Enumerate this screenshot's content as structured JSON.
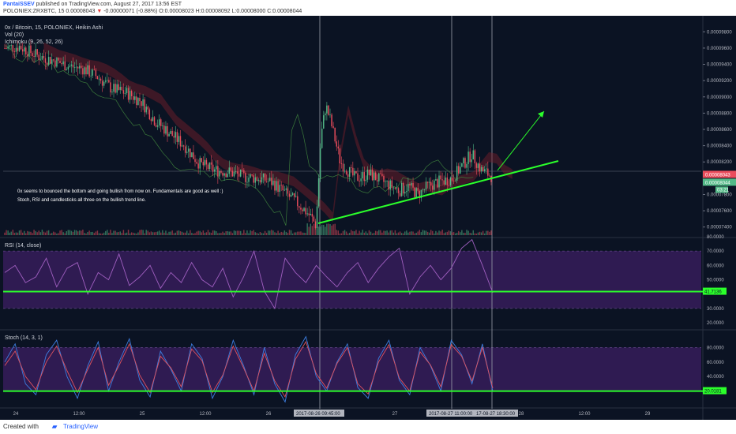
{
  "header": {
    "author": "PantaiSSEV",
    "published_text": "published on TradingView.com, August 27, 2017 13:56 EST",
    "symbol_line": "POLONIEX:ZRXBTC, 15",
    "price": "0.00008043",
    "change": "-0.00000071 (-0.88%)",
    "ohlc": "O:0.00008023 H:0.00008092 L:0.00008000 C:0.00008044"
  },
  "legend": {
    "title": "0x / Bitcoin, 15, POLONIEX, Heikin Ashi",
    "vol": "Vol (20)",
    "ichimoku": "Ichimoku (9, 26, 52, 26)",
    "rsi": "RSI (14, close)",
    "stoch": "Stoch (14, 3, 1)"
  },
  "annotation": {
    "line1": "0x seems to bounced the bottom and going bullish from now on. Fundamentals are good as well :)",
    "line2": "Stoch, RSI and candlesticks all three on the bullish trend line."
  },
  "footer": {
    "created_with": "Created with",
    "brand": "TradingView"
  },
  "colors": {
    "bg": "#0b1323",
    "up": "#53b987",
    "down": "#eb4d5c",
    "trend": "#2bff2b",
    "rsi": "#a05fc0",
    "stoch_k": "#3d7ee0",
    "stoch_d": "#e0535f",
    "band": "#3c1f63"
  },
  "chart_data": [
    {
      "type": "candlestick",
      "title": "0x / Bitcoin, 15, POLONIEX, Heikin Ashi",
      "ylim": [
        7.3e-05,
        9.9e-05
      ],
      "y_ticks": [
        "0.00009800",
        "0.00009600",
        "0.00009400",
        "0.00009200",
        "0.00009000",
        "0.00008800",
        "0.00008600",
        "0.00008400",
        "0.00008200",
        "0.00007800",
        "0.00007600",
        "0.00007400"
      ],
      "x_ticks": [
        "24",
        "12:00",
        "25",
        "12:00",
        "26",
        "12:00",
        "27",
        "12:00",
        "28",
        "12:00",
        "29"
      ],
      "price_path": [
        [
          0,
          9.6e-05
        ],
        [
          0.03,
          9.62e-05
        ],
        [
          0.07,
          9.5e-05
        ],
        [
          0.1,
          9.45e-05
        ],
        [
          0.13,
          9.38e-05
        ],
        [
          0.16,
          9.35e-05
        ],
        [
          0.19,
          9.25e-05
        ],
        [
          0.22,
          9.1e-05
        ],
        [
          0.25,
          9.05e-05
        ],
        [
          0.28,
          8.95e-05
        ],
        [
          0.31,
          8.7e-05
        ],
        [
          0.34,
          8.55e-05
        ],
        [
          0.37,
          8.4e-05
        ],
        [
          0.4,
          8.18e-05
        ],
        [
          0.43,
          8.1e-05
        ],
        [
          0.46,
          8.08e-05
        ],
        [
          0.49,
          8.02e-05
        ],
        [
          0.52,
          8e-05
        ],
        [
          0.55,
          7.95e-05
        ],
        [
          0.58,
          7.8e-05
        ],
        [
          0.61,
          7.65e-05
        ],
        [
          0.63,
          7.52e-05
        ],
        [
          0.64,
          7.42e-05
        ],
        [
          0.65,
          8.5e-05
        ],
        [
          0.66,
          8.9e-05
        ],
        [
          0.67,
          8.7e-05
        ],
        [
          0.69,
          8.2e-05
        ],
        [
          0.72,
          8e-05
        ],
        [
          0.75,
          8.05e-05
        ],
        [
          0.78,
          7.95e-05
        ],
        [
          0.81,
          7.85e-05
        ],
        [
          0.83,
          7.9e-05
        ],
        [
          0.85,
          7.8e-05
        ],
        [
          0.87,
          7.9e-05
        ],
        [
          0.89,
          7.95e-05
        ],
        [
          0.92,
          8e-05
        ],
        [
          0.94,
          8.15e-05
        ],
        [
          0.96,
          8.3e-05
        ],
        [
          0.98,
          8.1e-05
        ],
        [
          1.0,
          8.03e-05
        ]
      ],
      "current_price": "0.00008043",
      "bid_price": "0.00008044",
      "countdown": "03:21"
    },
    {
      "type": "line",
      "title": "RSI (14, close)",
      "ylim": [
        20,
        80
      ],
      "y_ticks": [
        "80.0000",
        "70.0000",
        "60.0000",
        "50.0000",
        "30.0000",
        "20.0000"
      ],
      "bands": [
        30,
        70
      ],
      "trend_level": 41.7136,
      "trend_label": "41.7136",
      "series": [
        {
          "values": [
            55,
            60,
            48,
            52,
            65,
            45,
            58,
            62,
            40,
            55,
            50,
            68,
            46,
            52,
            60,
            44,
            55,
            48,
            62,
            50,
            45,
            58,
            38,
            52,
            70,
            42,
            30,
            65,
            55,
            48,
            60,
            52,
            45,
            55,
            62,
            48,
            58,
            66,
            72,
            40,
            52,
            60,
            50,
            58,
            72,
            78,
            60,
            41
          ]
        }
      ]
    },
    {
      "type": "line",
      "title": "Stoch (14, 3, 1)",
      "ylim": [
        0,
        100
      ],
      "y_ticks": [
        "80.0000",
        "60.0000",
        "40.0000"
      ],
      "bands": [
        20,
        80
      ],
      "trend_level": 20.0181,
      "trend_label": "20.0181",
      "series": [
        {
          "values": [
            60,
            85,
            30,
            15,
            70,
            90,
            40,
            10,
            55,
            88,
            20,
            60,
            92,
            35,
            12,
            75,
            50,
            20,
            85,
            65,
            10,
            40,
            90,
            55,
            15,
            80,
            30,
            5,
            70,
            95,
            40,
            20,
            60,
            85,
            25,
            10,
            65,
            90,
            35,
            15,
            80,
            55,
            20,
            90,
            70,
            30,
            85,
            20
          ]
        },
        {
          "values": [
            55,
            75,
            40,
            22,
            60,
            82,
            48,
            18,
            50,
            80,
            28,
            55,
            85,
            42,
            18,
            68,
            52,
            26,
            78,
            62,
            18,
            42,
            82,
            52,
            20,
            72,
            34,
            12,
            64,
            88,
            44,
            24,
            58,
            80,
            30,
            16,
            60,
            84,
            38,
            20,
            74,
            56,
            26,
            84,
            68,
            34,
            80,
            24
          ]
        }
      ]
    }
  ],
  "marker_dates": [
    "2017-08-26 09:45:00",
    "2017-08-27 11:00:00",
    "17-08-27 18:30:00"
  ]
}
